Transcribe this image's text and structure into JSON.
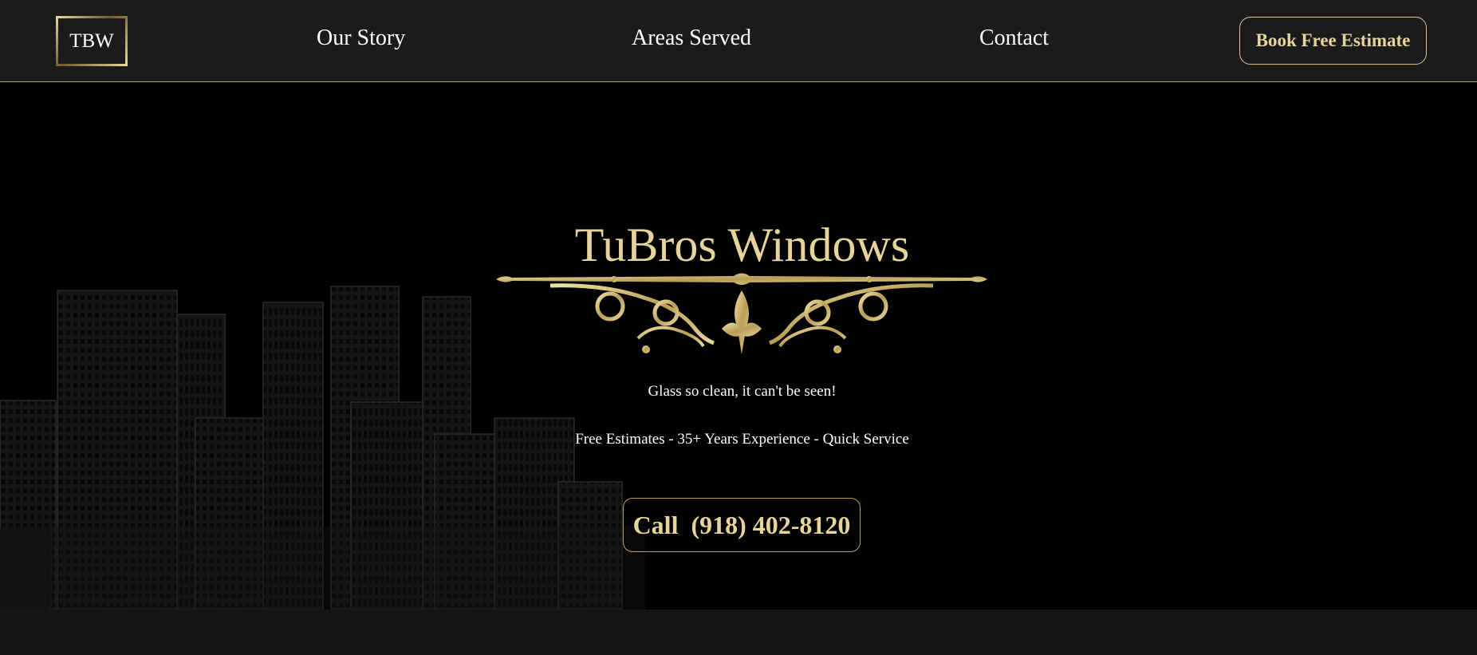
{
  "brand": {
    "logo_text": "TBW"
  },
  "nav": {
    "items": [
      {
        "label": "Our Story"
      },
      {
        "label": "Areas Served"
      },
      {
        "label": "Contact"
      }
    ],
    "cta_label": "Book Free Estimate"
  },
  "hero": {
    "title": "TuBros Windows",
    "tagline": "Glass so clean, it can't be seen!",
    "features": "Free Estimates - 35+ Years Experience - Quick Service",
    "call_label": "Call  (918) 402-8120"
  },
  "colors": {
    "header_bg": "#1b1b1b",
    "page_bg": "#000000",
    "gold": "#e6d49a",
    "gold_dark": "#b59f5f",
    "text": "#ffffff"
  },
  "icons": {
    "divider": "ornamental-flourish",
    "background": "city-skyline-illustration"
  }
}
